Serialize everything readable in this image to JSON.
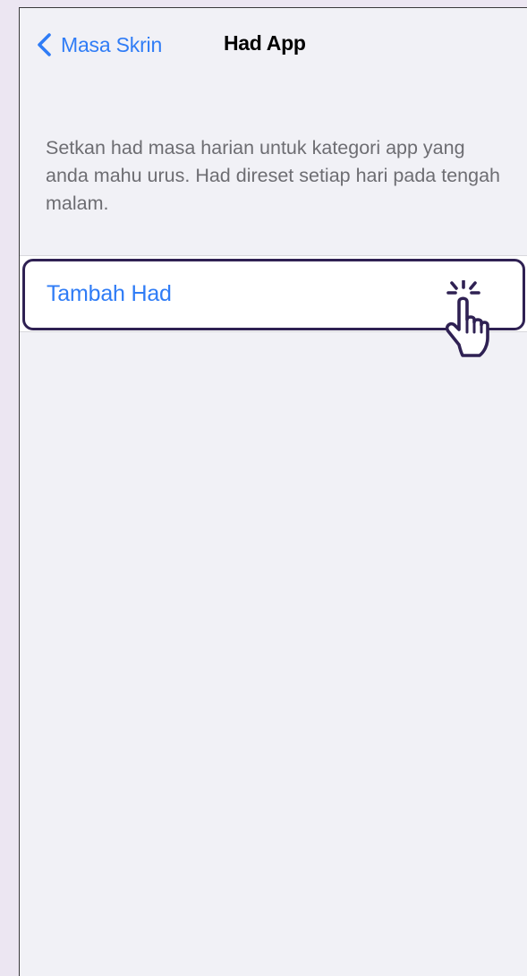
{
  "nav": {
    "back_label": "Masa Skrin",
    "title": "Had App"
  },
  "description": "Setkan had masa harian untuk kategori app yang anda mahu urus. Had direset setiap hari pada tengah malam.",
  "list": {
    "add_limit_label": "Tambah Had"
  },
  "colors": {
    "accent": "#2f7cf6",
    "highlight_border": "#2f2153",
    "background": "#f1f1f6",
    "page_frame": "#ece6f2"
  },
  "icons": {
    "back": "chevron-left-icon",
    "tap": "tap-hand-icon"
  }
}
